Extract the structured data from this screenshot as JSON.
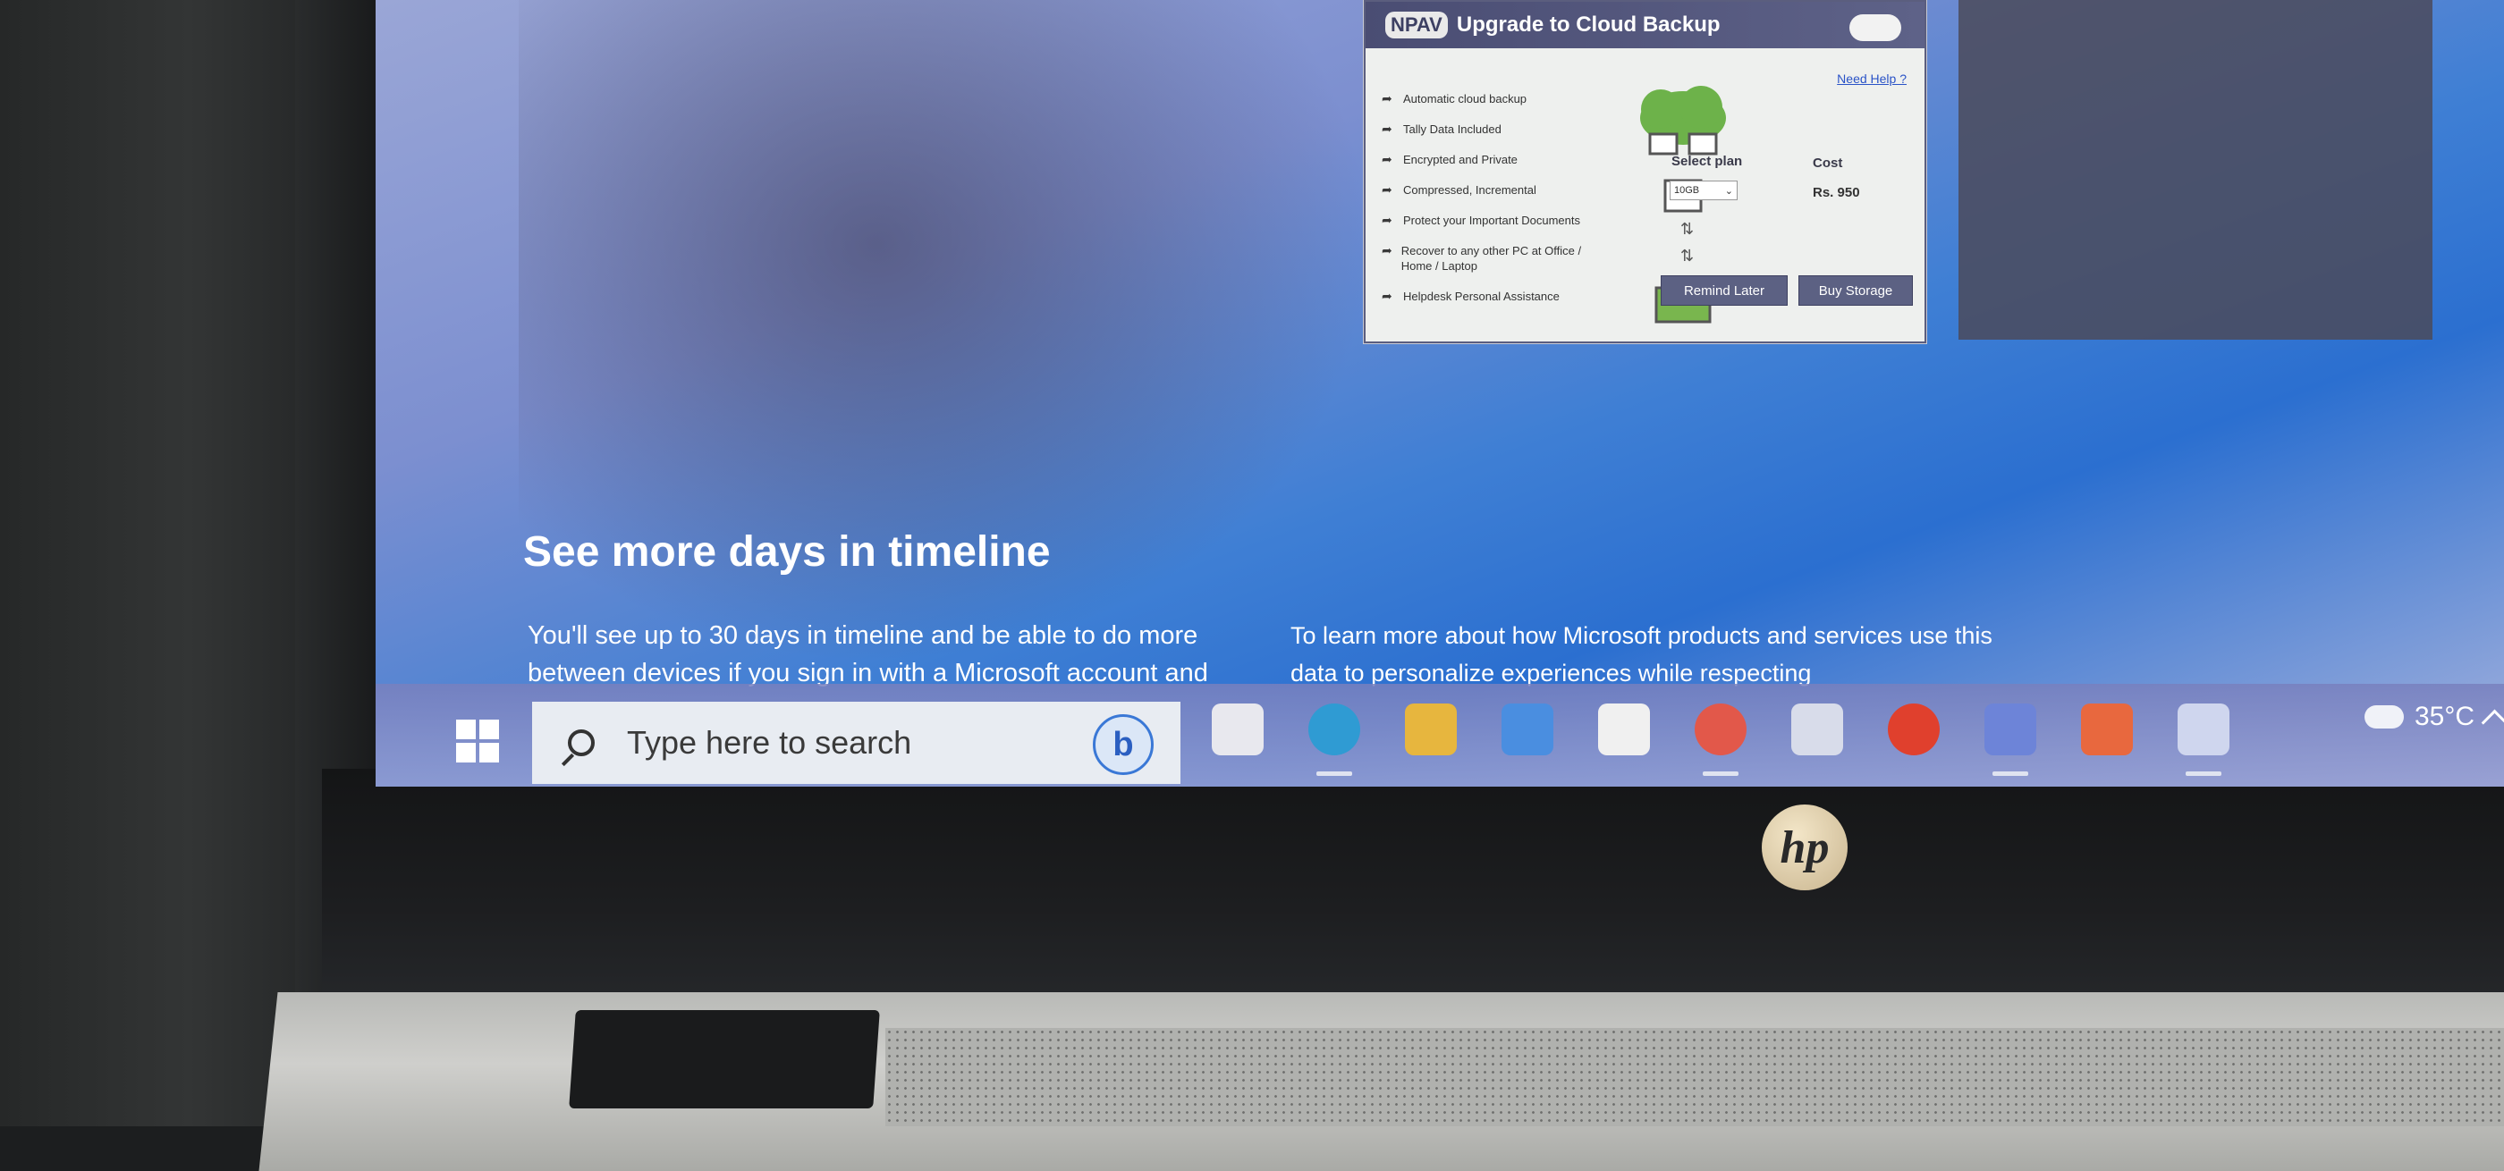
{
  "popup": {
    "badge": "NPAV",
    "title": "Upgrade to Cloud Backup",
    "help_link": "Need Help ?",
    "features": [
      "Automatic cloud backup",
      "Tally Data Included",
      "Encrypted and Private",
      "Compressed, Incremental",
      "Protect your Important Documents",
      "Recover to any other PC at Office / Home / Laptop",
      "Helpdesk Personal Assistance"
    ],
    "select_plan_label": "Select plan",
    "plan_value": "10GB",
    "cost_label": "Cost",
    "cost_value": "Rs. 950",
    "remind_button": "Remind Later",
    "buy_button": "Buy Storage"
  },
  "timeline": {
    "title": "See more days in timeline",
    "para1": "You'll see up to 30 days in timeline and be able to do more between devices if you sign in with a Microsoft account and",
    "para2": "To learn more about how Microsoft products and services use this data to personalize experiences while respecting"
  },
  "taskbar": {
    "search_placeholder": "Type here to search",
    "bing_letter": "b",
    "apps": [
      {
        "name": "task-view",
        "color": "#e8e8ee"
      },
      {
        "name": "edge",
        "color": "#2f9bd3"
      },
      {
        "name": "file-explorer",
        "color": "#e7b63e"
      },
      {
        "name": "mail",
        "color": "#4a8ee0"
      },
      {
        "name": "microsoft-store",
        "color": "#f0f0f0"
      },
      {
        "name": "chrome",
        "color": "#e2584a"
      },
      {
        "name": "magnifier",
        "color": "#d8dcea"
      },
      {
        "name": "opera",
        "color": "#e0402d"
      },
      {
        "name": "copilot",
        "color": "#6d84d8"
      },
      {
        "name": "sticky-app",
        "color": "#e8683e"
      },
      {
        "name": "onedrive",
        "color": "#cfd6ee"
      }
    ],
    "temperature": "35°C"
  },
  "brand": {
    "logo": "hp"
  }
}
